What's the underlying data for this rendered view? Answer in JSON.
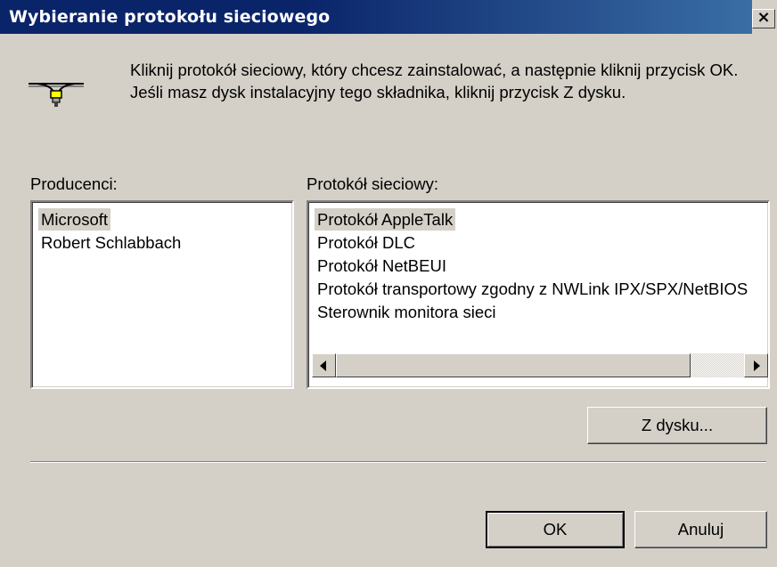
{
  "dialog": {
    "title": "Wybieranie protokołu sieciowego",
    "close_label": "×",
    "instruction": "Kliknij protokół sieciowy, który chcesz zainstalować, a następnie kliknij przycisk OK. Jeśli masz dysk instalacyjny tego składnika, kliknij przycisk Z dysku."
  },
  "icons": {
    "intro": "network-protocol-icon"
  },
  "manufacturers": {
    "label": "Producenci:",
    "items": [
      "Microsoft",
      "Robert Schlabbach"
    ],
    "selected_index": 0
  },
  "protocols": {
    "label": "Protokół sieciowy:",
    "items": [
      "Protokół AppleTalk",
      "Protokół DLC",
      "Protokół NetBEUI",
      "Protokół transportowy zgodny z NWLink IPX/SPX/NetBIOS",
      "Sterownik monitora sieci"
    ],
    "selected_index": 0,
    "scroll_position": 0
  },
  "buttons": {
    "have_disk": "Z dysku...",
    "ok": "OK",
    "cancel": "Anuluj"
  },
  "colors": {
    "title_bar": "#0a246a",
    "face": "#d4d0c8",
    "selection": "#d4d0c8"
  }
}
